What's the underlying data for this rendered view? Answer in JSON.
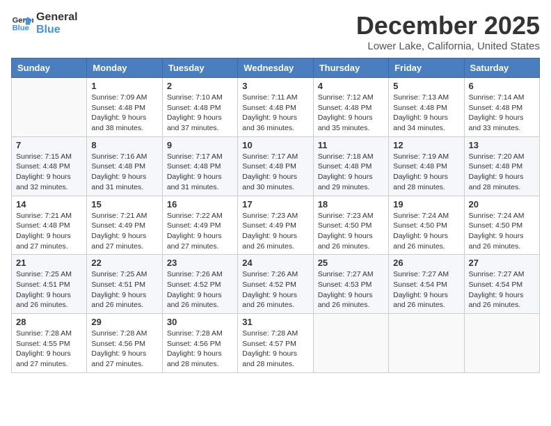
{
  "logo": {
    "line1": "General",
    "line2": "Blue"
  },
  "title": "December 2025",
  "location": "Lower Lake, California, United States",
  "weekdays": [
    "Sunday",
    "Monday",
    "Tuesday",
    "Wednesday",
    "Thursday",
    "Friday",
    "Saturday"
  ],
  "weeks": [
    [
      {
        "day": "",
        "info": ""
      },
      {
        "day": "1",
        "info": "Sunrise: 7:09 AM\nSunset: 4:48 PM\nDaylight: 9 hours\nand 38 minutes."
      },
      {
        "day": "2",
        "info": "Sunrise: 7:10 AM\nSunset: 4:48 PM\nDaylight: 9 hours\nand 37 minutes."
      },
      {
        "day": "3",
        "info": "Sunrise: 7:11 AM\nSunset: 4:48 PM\nDaylight: 9 hours\nand 36 minutes."
      },
      {
        "day": "4",
        "info": "Sunrise: 7:12 AM\nSunset: 4:48 PM\nDaylight: 9 hours\nand 35 minutes."
      },
      {
        "day": "5",
        "info": "Sunrise: 7:13 AM\nSunset: 4:48 PM\nDaylight: 9 hours\nand 34 minutes."
      },
      {
        "day": "6",
        "info": "Sunrise: 7:14 AM\nSunset: 4:48 PM\nDaylight: 9 hours\nand 33 minutes."
      }
    ],
    [
      {
        "day": "7",
        "info": "Sunrise: 7:15 AM\nSunset: 4:48 PM\nDaylight: 9 hours\nand 32 minutes."
      },
      {
        "day": "8",
        "info": "Sunrise: 7:16 AM\nSunset: 4:48 PM\nDaylight: 9 hours\nand 31 minutes."
      },
      {
        "day": "9",
        "info": "Sunrise: 7:17 AM\nSunset: 4:48 PM\nDaylight: 9 hours\nand 31 minutes."
      },
      {
        "day": "10",
        "info": "Sunrise: 7:17 AM\nSunset: 4:48 PM\nDaylight: 9 hours\nand 30 minutes."
      },
      {
        "day": "11",
        "info": "Sunrise: 7:18 AM\nSunset: 4:48 PM\nDaylight: 9 hours\nand 29 minutes."
      },
      {
        "day": "12",
        "info": "Sunrise: 7:19 AM\nSunset: 4:48 PM\nDaylight: 9 hours\nand 28 minutes."
      },
      {
        "day": "13",
        "info": "Sunrise: 7:20 AM\nSunset: 4:48 PM\nDaylight: 9 hours\nand 28 minutes."
      }
    ],
    [
      {
        "day": "14",
        "info": "Sunrise: 7:21 AM\nSunset: 4:48 PM\nDaylight: 9 hours\nand 27 minutes."
      },
      {
        "day": "15",
        "info": "Sunrise: 7:21 AM\nSunset: 4:49 PM\nDaylight: 9 hours\nand 27 minutes."
      },
      {
        "day": "16",
        "info": "Sunrise: 7:22 AM\nSunset: 4:49 PM\nDaylight: 9 hours\nand 27 minutes."
      },
      {
        "day": "17",
        "info": "Sunrise: 7:23 AM\nSunset: 4:49 PM\nDaylight: 9 hours\nand 26 minutes."
      },
      {
        "day": "18",
        "info": "Sunrise: 7:23 AM\nSunset: 4:50 PM\nDaylight: 9 hours\nand 26 minutes."
      },
      {
        "day": "19",
        "info": "Sunrise: 7:24 AM\nSunset: 4:50 PM\nDaylight: 9 hours\nand 26 minutes."
      },
      {
        "day": "20",
        "info": "Sunrise: 7:24 AM\nSunset: 4:50 PM\nDaylight: 9 hours\nand 26 minutes."
      }
    ],
    [
      {
        "day": "21",
        "info": "Sunrise: 7:25 AM\nSunset: 4:51 PM\nDaylight: 9 hours\nand 26 minutes."
      },
      {
        "day": "22",
        "info": "Sunrise: 7:25 AM\nSunset: 4:51 PM\nDaylight: 9 hours\nand 26 minutes."
      },
      {
        "day": "23",
        "info": "Sunrise: 7:26 AM\nSunset: 4:52 PM\nDaylight: 9 hours\nand 26 minutes."
      },
      {
        "day": "24",
        "info": "Sunrise: 7:26 AM\nSunset: 4:52 PM\nDaylight: 9 hours\nand 26 minutes."
      },
      {
        "day": "25",
        "info": "Sunrise: 7:27 AM\nSunset: 4:53 PM\nDaylight: 9 hours\nand 26 minutes."
      },
      {
        "day": "26",
        "info": "Sunrise: 7:27 AM\nSunset: 4:54 PM\nDaylight: 9 hours\nand 26 minutes."
      },
      {
        "day": "27",
        "info": "Sunrise: 7:27 AM\nSunset: 4:54 PM\nDaylight: 9 hours\nand 26 minutes."
      }
    ],
    [
      {
        "day": "28",
        "info": "Sunrise: 7:28 AM\nSunset: 4:55 PM\nDaylight: 9 hours\nand 27 minutes."
      },
      {
        "day": "29",
        "info": "Sunrise: 7:28 AM\nSunset: 4:56 PM\nDaylight: 9 hours\nand 27 minutes."
      },
      {
        "day": "30",
        "info": "Sunrise: 7:28 AM\nSunset: 4:56 PM\nDaylight: 9 hours\nand 28 minutes."
      },
      {
        "day": "31",
        "info": "Sunrise: 7:28 AM\nSunset: 4:57 PM\nDaylight: 9 hours\nand 28 minutes."
      },
      {
        "day": "",
        "info": ""
      },
      {
        "day": "",
        "info": ""
      },
      {
        "day": "",
        "info": ""
      }
    ]
  ]
}
